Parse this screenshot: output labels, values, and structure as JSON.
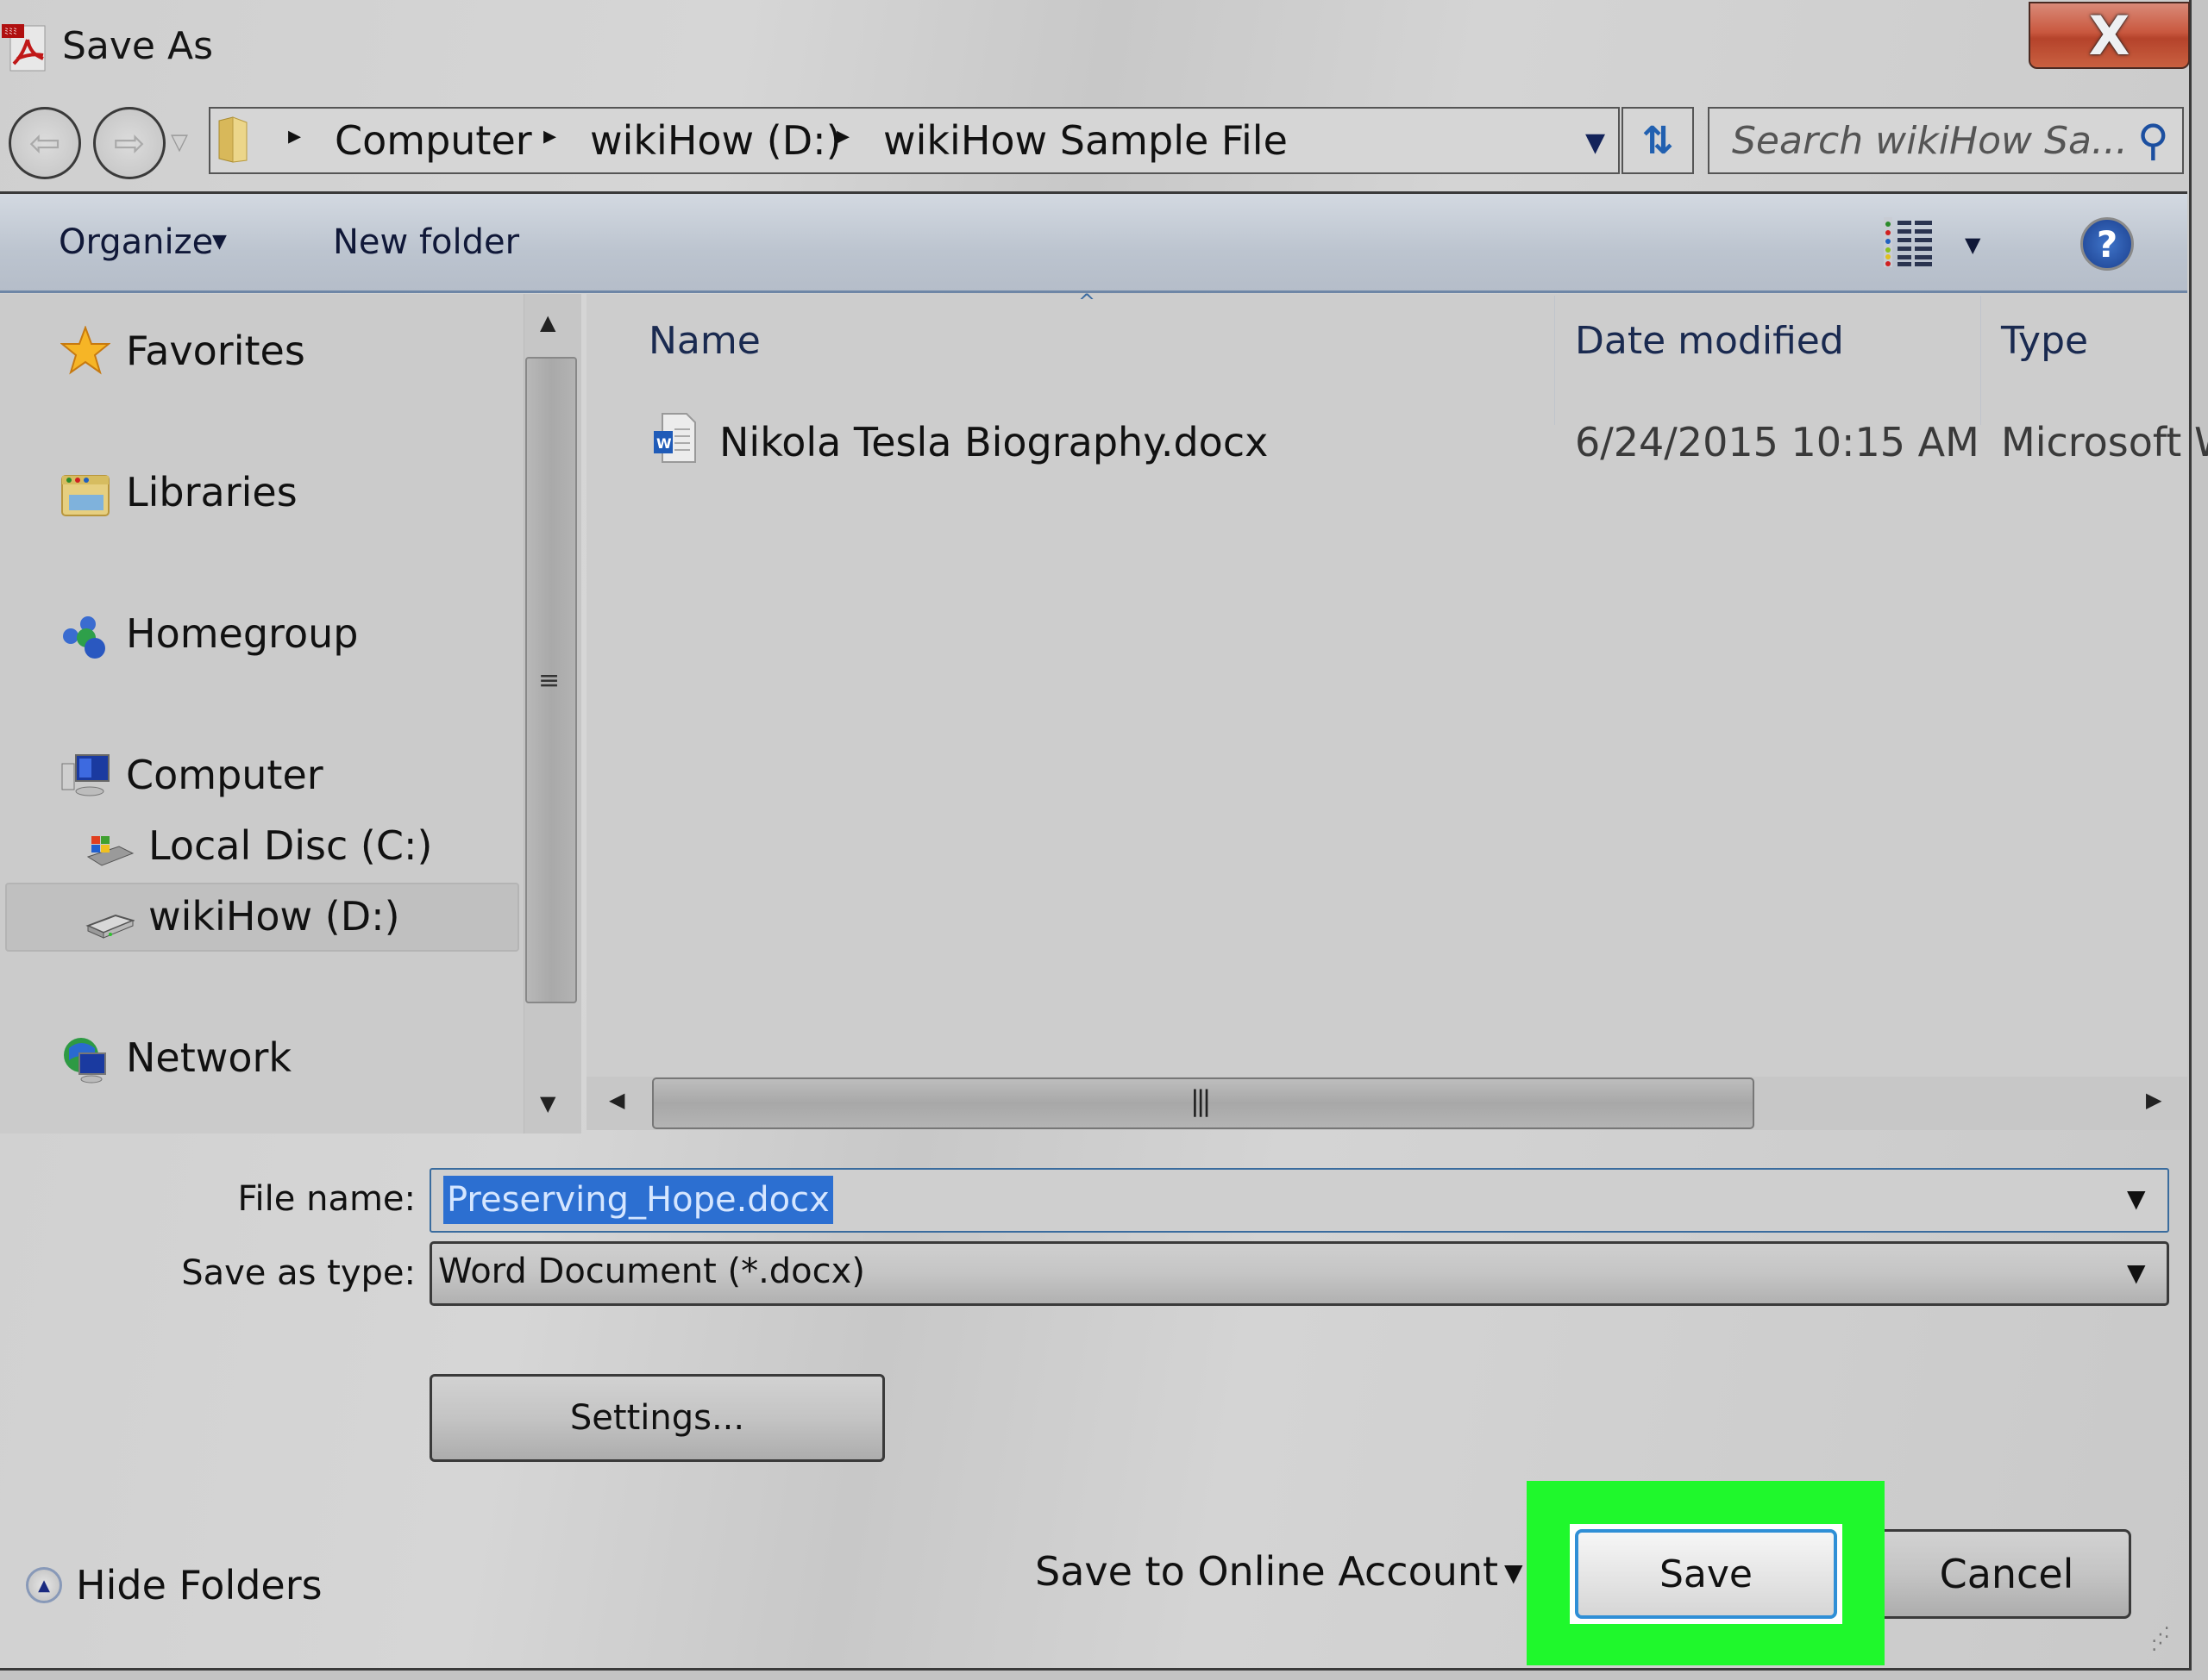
{
  "window": {
    "title": "Save As",
    "close_label": "X"
  },
  "address_bar": {
    "breadcrumbs": [
      "Computer",
      "wikiHow (D:)",
      "wikiHow Sample File"
    ],
    "separator": "▸",
    "search_placeholder": "Search wikiHow Sa..."
  },
  "toolbar": {
    "organize_label": "Organize",
    "new_folder_label": "New folder",
    "help_label": "?"
  },
  "nav_pane": {
    "items": [
      {
        "label": "Favorites",
        "icon": "star-icon"
      },
      {
        "label": "Libraries",
        "icon": "libraries-icon"
      },
      {
        "label": "Homegroup",
        "icon": "homegroup-icon"
      },
      {
        "label": "Computer",
        "icon": "computer-icon"
      },
      {
        "label": "Local Disc (C:)",
        "icon": "system-drive-icon"
      },
      {
        "label": "wikiHow (D:)",
        "icon": "drive-icon",
        "selected": true
      },
      {
        "label": "Network",
        "icon": "network-icon"
      }
    ]
  },
  "file_list": {
    "columns": [
      "Name",
      "Date modified",
      "Type"
    ],
    "rows": [
      {
        "name": "Nikola Tesla Biography.docx",
        "date_modified": "6/24/2015 10:15 AM",
        "type": "Microsoft W",
        "icon": "word-document-icon"
      }
    ]
  },
  "form": {
    "file_name_label": "File name:",
    "file_name_value": "Preserving_Hope.docx",
    "save_as_type_label": "Save as type:",
    "save_as_type_value": "Word Document (*.docx)",
    "settings_label": "Settings..."
  },
  "footer": {
    "hide_folders_label": "Hide Folders",
    "save_online_label": "Save to Online Account",
    "save_label": "Save",
    "cancel_label": "Cancel",
    "highlight_color": "#1ff82c"
  }
}
